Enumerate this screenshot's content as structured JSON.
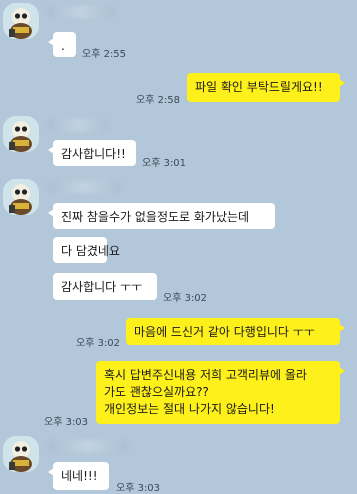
{
  "messages": {
    "m1": {
      "text": ".",
      "time": "오후 2:55"
    },
    "m2": {
      "text": "파일 확인 부탁드릴게요!!",
      "time": "오후 2:58"
    },
    "m3": {
      "text": "감사합니다!!",
      "time": "오후 3:01"
    },
    "m4": {
      "text": "진짜 참을수가 없을정도로 화가났는데"
    },
    "m5": {
      "text": "다 담겼네요"
    },
    "m6": {
      "text": "감사합니다 ㅜㅜ",
      "time": "오후 3:02"
    },
    "m7": {
      "text": "마음에 드신거 같아 다행입니다 ㅜㅜ",
      "time": "오후 3:02"
    },
    "m8": {
      "lines": [
        "혹시 답변주신내용 저희 고객리뷰에 올라",
        "가도 괜찮으실까요??",
        "개인정보는 절대 나가지 않습니다!"
      ],
      "time": "오후 3:03"
    },
    "m9": {
      "text": "네네!!!",
      "time": "오후 3:03"
    }
  },
  "colors": {
    "background": "#b2c7d9",
    "incoming_bubble": "#ffffff",
    "outgoing_bubble": "#fef01b"
  },
  "avatar_icon": "character-avatar-icon"
}
